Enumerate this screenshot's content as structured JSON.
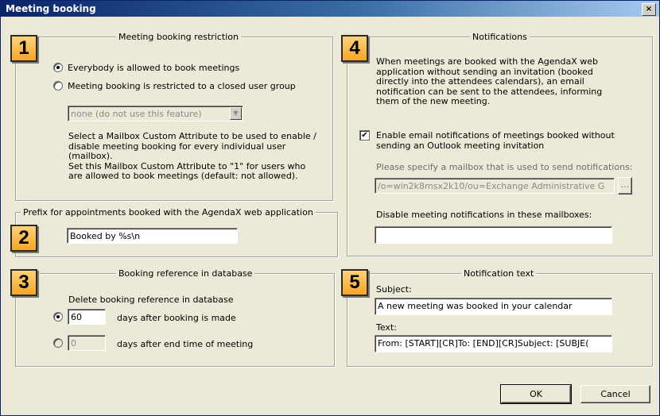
{
  "window": {
    "title": "Meeting booking",
    "close_label": "×"
  },
  "section1": {
    "badge": "1",
    "legend": "Meeting booking restriction",
    "radio_everybody": "Everybody is allowed to book meetings",
    "radio_closed_group": "Meeting booking is restricted to a closed user group",
    "attribute_select_value": "none (do not use this feature)",
    "description": "Select a Mailbox Custom Attribute to be used to enable /\ndisable meeting booking for every individual user\n(mailbox).\nSet this Mailbox Custom Attribute to \"1\" for users who\nare allowed to book meetings (default: not allowed).",
    "selected": "everybody"
  },
  "section2": {
    "badge": "2",
    "legend": "Prefix for appointments booked with the AgendaX web application",
    "prefix_value": "Booked by %s\\n"
  },
  "section3": {
    "badge": "3",
    "legend": "Booking reference in database",
    "delete_label": "Delete booking reference in database",
    "after_booking_value": "60",
    "after_booking_label": "days after booking is made",
    "after_end_value": "0",
    "after_end_label": "days after end time of meeting",
    "selected": "after_booking"
  },
  "section4": {
    "badge": "4",
    "legend": "Notifications",
    "description": "When meetings are booked with the AgendaX web\napplication without sending an invitation (booked\ndirectly into the attendees calendars), an email\nnotification can be sent to the attendees, informing\nthem of the new meeting.",
    "enable_label": "Enable email notifications of meetings booked without\nsending an Outlook meeting invitation",
    "enable_checked": true,
    "mailbox_label": "Please specify a mailbox that is used to send notifications:",
    "mailbox_value": "/o=win2k8msx2k10/ou=Exchange Administrative G",
    "browse_label": "...",
    "disable_label": "Disable meeting notifications in these mailboxes:",
    "disable_value": ""
  },
  "section5": {
    "badge": "5",
    "legend": "Notification text",
    "subject_label": "Subject:",
    "subject_value": "A new meeting was booked in your calendar",
    "text_label": "Text:",
    "text_value": "From: [START][CR]To: [END][CR]Subject: [SUBJE("
  },
  "buttons": {
    "ok": "OK",
    "cancel": "Cancel"
  }
}
